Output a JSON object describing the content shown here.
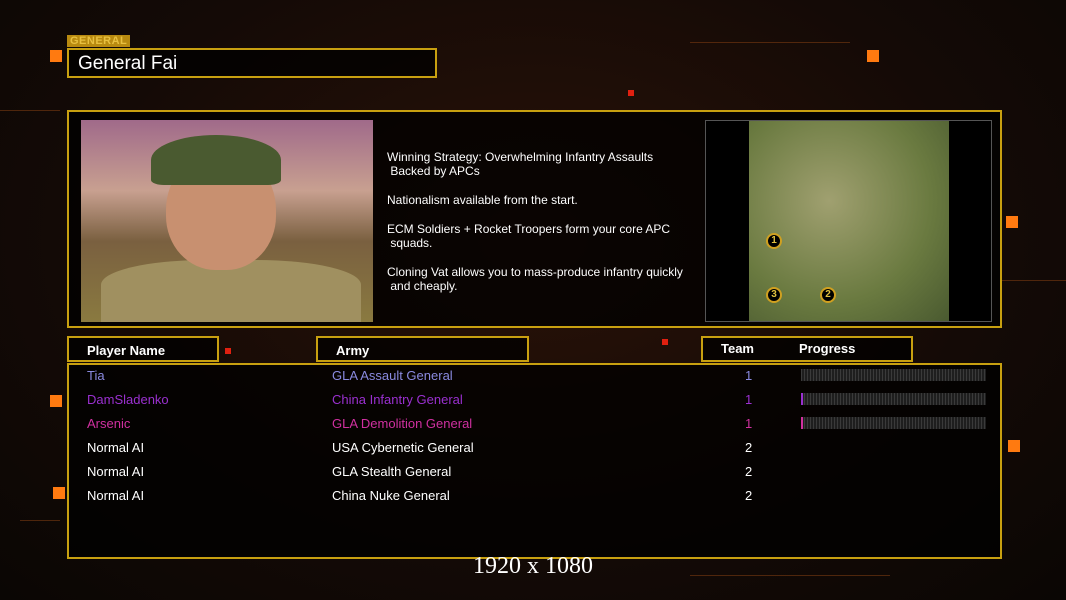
{
  "general": {
    "tag": "GENERAL",
    "name": "General Fai"
  },
  "strategy": [
    "Winning Strategy: Overwhelming Infantry Assaults\n Backed by APCs",
    "Nationalism available from the start.",
    "ECM Soldiers + Rocket Troopers form your core APC\n squads.",
    "Cloning Vat allows you to mass-produce infantry quickly\n and cheaply."
  ],
  "map": {
    "start_positions": [
      "1",
      "2",
      "3"
    ]
  },
  "headers": {
    "player": "Player Name",
    "army": "Army",
    "team": "Team",
    "progress": "Progress"
  },
  "players": [
    {
      "name": "Tia",
      "army": "GLA Assault General",
      "team": "1",
      "color": "#8a8ae0",
      "progress": 0
    },
    {
      "name": "DamSladenko",
      "army": "China Infantry General",
      "team": "1",
      "color": "#9a30d0",
      "progress": 1
    },
    {
      "name": "Arsenic",
      "army": "GLA Demolition General",
      "team": "1",
      "color": "#d030a0",
      "progress": 1
    },
    {
      "name": "Normal AI",
      "army": "USA Cybernetic General",
      "team": "2",
      "color": "#ffffff",
      "progress": null
    },
    {
      "name": "Normal AI",
      "army": "GLA Stealth General",
      "team": "2",
      "color": "#ffffff",
      "progress": null
    },
    {
      "name": "Normal AI",
      "army": "China Nuke General",
      "team": "2",
      "color": "#ffffff",
      "progress": null
    }
  ],
  "resolution": "1920 x 1080"
}
